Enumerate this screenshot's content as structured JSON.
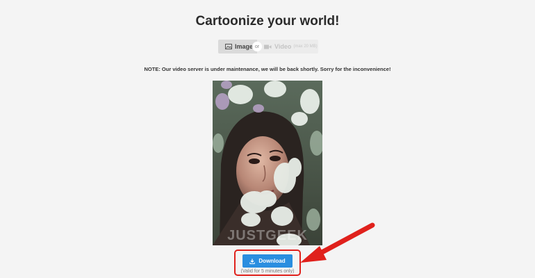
{
  "page": {
    "title": "Cartoonize your world!",
    "note": "NOTE: Our video server is under maintenance, we will be back shortly. Sorry for the inconvenience!"
  },
  "mode_toggle": {
    "image_label": "Image",
    "or_label": "or",
    "video_label": "Video",
    "video_sublabel": "(max 20 MB)",
    "image_icon": "image-icon",
    "video_icon": "video-camera-icon"
  },
  "result": {
    "watermark": "JUSTGEEK"
  },
  "download": {
    "label": "Download",
    "icon": "download-icon",
    "validity": "(Valid for 5 minutes only)"
  },
  "colors": {
    "primary_button": "#2a8ee0",
    "highlight": "#e0211c",
    "background": "#f4f4f4"
  }
}
